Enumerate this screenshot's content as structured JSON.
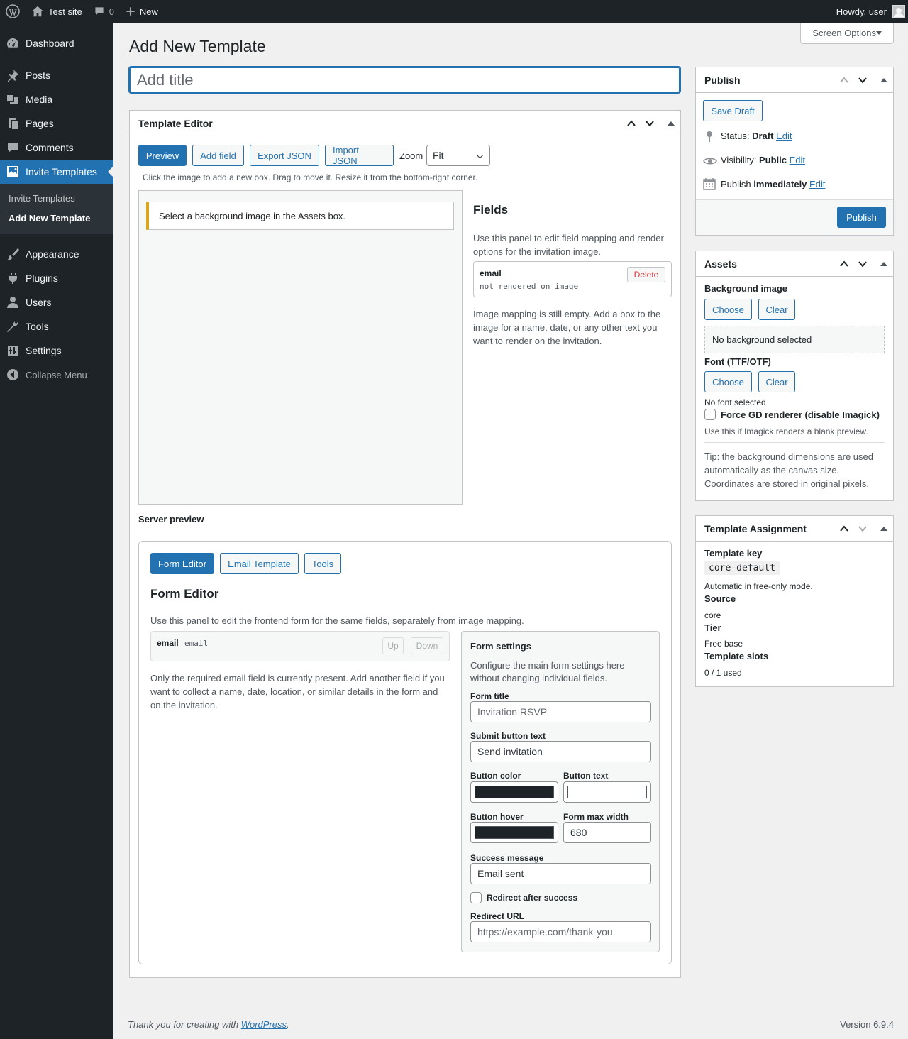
{
  "adminbar": {
    "site_name": "Test site",
    "comments_count": "0",
    "new_label": "New",
    "howdy": "Howdy, user"
  },
  "sidebar": {
    "items": [
      {
        "label": "Dashboard",
        "icon": "dashboard-icon"
      },
      {
        "label": "Posts",
        "icon": "pin-icon"
      },
      {
        "label": "Media",
        "icon": "media-icon"
      },
      {
        "label": "Pages",
        "icon": "pages-icon"
      },
      {
        "label": "Comments",
        "icon": "comment-icon"
      },
      {
        "label": "Invite Templates",
        "icon": "image-icon"
      },
      {
        "label": "Appearance",
        "icon": "brush-icon"
      },
      {
        "label": "Plugins",
        "icon": "plugin-icon"
      },
      {
        "label": "Users",
        "icon": "user-icon"
      },
      {
        "label": "Tools",
        "icon": "wrench-icon"
      },
      {
        "label": "Settings",
        "icon": "settings-icon"
      }
    ],
    "submenu": [
      "Invite Templates",
      "Add New Template"
    ],
    "collapse_label": "Collapse Menu"
  },
  "header": {
    "screen_options": "Screen Options",
    "page_title": "Add New Template",
    "title_placeholder": "Add title"
  },
  "template_editor": {
    "heading": "Template Editor",
    "buttons": {
      "preview": "Preview",
      "add_field": "Add field",
      "export": "Export JSON",
      "import": "Import JSON"
    },
    "zoom_label": "Zoom",
    "zoom_value": "Fit",
    "hint": "Click the image to add a new box. Drag to move it. Resize it from the bottom-right corner.",
    "notice": "Select a background image in the Assets box.",
    "fields_heading": "Fields",
    "fields_desc": [
      "Use this panel to edit field mapping and render",
      "options for the invitation image."
    ],
    "field_card": {
      "name": "email",
      "meta": "not rendered on image",
      "delete": "Delete"
    },
    "fields_empty": [
      "Image mapping is still empty. Add a box to the",
      "image for a name, date, or any other text you",
      "want to render on the invitation."
    ],
    "server_preview": "Server preview"
  },
  "form_editor": {
    "tabs": [
      "Form Editor",
      "Email Template",
      "Tools"
    ],
    "heading": "Form Editor",
    "desc": "Use this panel to edit the frontend form for the same fields, separately from image mapping.",
    "field_row": {
      "label": "email",
      "type": "email",
      "up": "Up",
      "down": "Down"
    },
    "empty_note": [
      "Only the required email field is currently present. Add another field if you",
      "want to collect a name, date, location, or similar details in the form and",
      "on the invitation."
    ],
    "settings": {
      "heading": "Form settings",
      "desc": [
        "Configure the main form settings here",
        "without changing individual fields."
      ],
      "form_title_label": "Form title",
      "form_title_placeholder": "Invitation RSVP",
      "submit_label": "Submit button text",
      "submit_value": "Send invitation",
      "button_color_label": "Button color",
      "button_color": "#1d2327",
      "button_text_label": "Button text",
      "button_text_color": "#ffffff",
      "button_hover_label": "Button hover",
      "button_hover_color": "#1d2327",
      "max_width_label": "Form max width",
      "max_width_value": "680",
      "success_label": "Success message",
      "success_value": "Email sent",
      "redirect_check_label": "Redirect after success",
      "redirect_url_label": "Redirect URL",
      "redirect_url_placeholder": "https://example.com/thank-you"
    }
  },
  "publish": {
    "heading": "Publish",
    "save_draft": "Save Draft",
    "status_label": "Status:",
    "status_value": "Draft",
    "visibility_label": "Visibility:",
    "visibility_value": "Public",
    "publish_label": "Publish",
    "publish_value": "immediately",
    "edit": "Edit",
    "publish_button": "Publish"
  },
  "assets": {
    "heading": "Assets",
    "bg_label": "Background image",
    "choose": "Choose",
    "clear": "Clear",
    "no_bg": "No background selected",
    "font_label": "Font (TTF/OTF)",
    "no_font": "No font selected",
    "force_gd": "Force GD renderer (disable Imagick)",
    "force_gd_help": "Use this if Imagick renders a blank preview.",
    "tip": [
      "Tip: the background dimensions are used",
      "automatically as the canvas size.",
      "Coordinates are stored in original pixels."
    ]
  },
  "assignment": {
    "heading": "Template Assignment",
    "key_label": "Template key",
    "key_value": "core-default",
    "key_note": "Automatic in free-only mode.",
    "source_label": "Source",
    "source_value": "core",
    "tier_label": "Tier",
    "tier_value": "Free base",
    "slots_label": "Template slots",
    "slots_value": "0 / 1 used"
  },
  "footer": {
    "thanks_prefix": "Thank you for creating with ",
    "thanks_link": "WordPress",
    "thanks_suffix": ".",
    "version": "Version 6.9.4"
  }
}
